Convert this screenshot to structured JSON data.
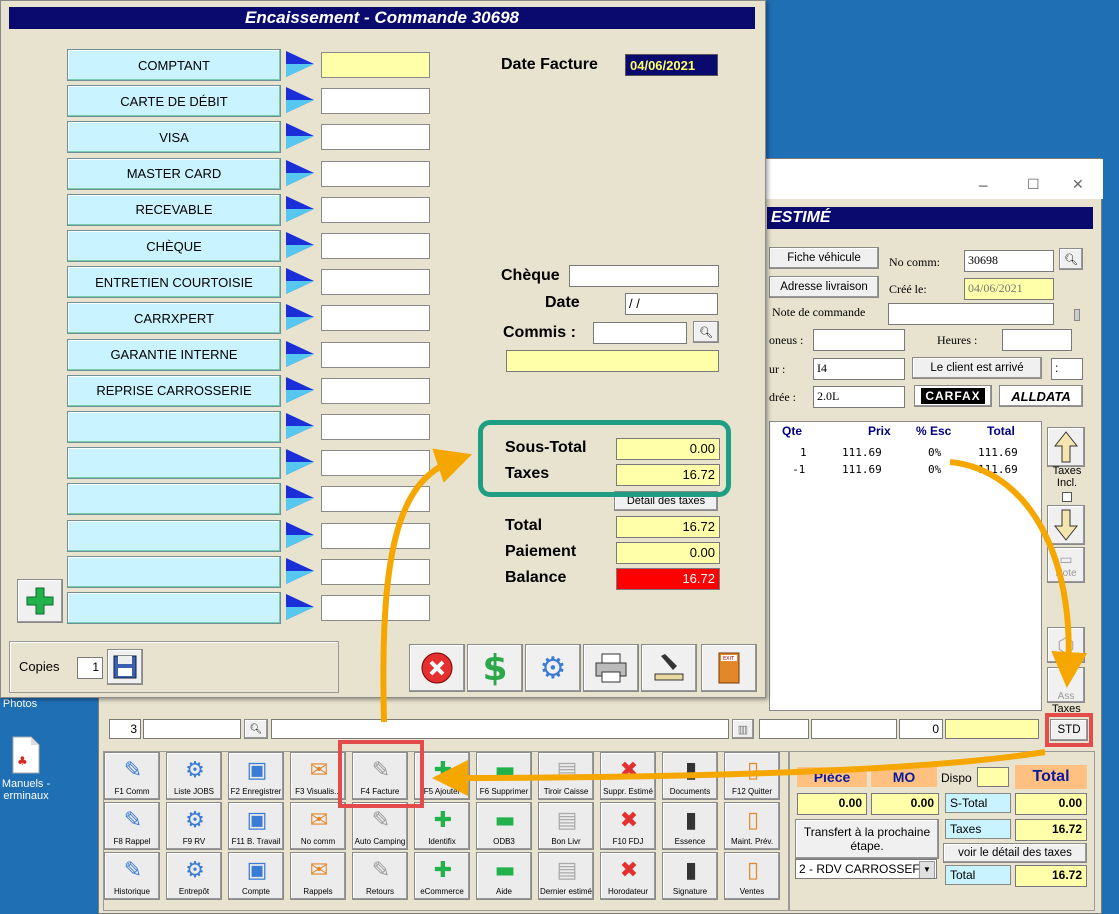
{
  "desktop": {
    "icon1_label": "Photos",
    "icon2_label": "Manuels -\nerminaux"
  },
  "front": {
    "title": "Encaissement - Commande 30698",
    "payment_methods": [
      "COMPTANT",
      "CARTE DE DÉBIT",
      "VISA",
      "MASTER CARD",
      "RECEVABLE",
      "CHÈQUE",
      "ENTRETIEN COURTOISIE",
      "CARRXPERT",
      "GARANTIE INTERNE",
      "REPRISE CARROSSERIE",
      "",
      "",
      "",
      "",
      "",
      ""
    ],
    "date_facture_label": "Date Facture",
    "date_facture_value": "04/06/2021",
    "cheque_label": "Chèque",
    "date_label": "Date",
    "date_value": " / /",
    "commis_label": "Commis :",
    "sous_total_label": "Sous-Total",
    "sous_total_value": "0.00",
    "taxes_label": "Taxes",
    "taxes_value": "16.72",
    "detail_taxes_btn": "Détail des taxes",
    "total_label": "Total",
    "total_value": "16.72",
    "paiement_label": "Paiement",
    "paiement_value": "0.00",
    "balance_label": "Balance",
    "balance_value": "16.72",
    "copies_label": "Copies",
    "copies_value": "1",
    "colors": {
      "balance_bg": "#ff0000",
      "title_bg": "#0a0a6e",
      "pay_btn_bg": "#c9f3ff"
    }
  },
  "back": {
    "title": "ESTIMÉ",
    "fiche_btn": "Fiche véhicule",
    "adresse_btn": "Adresse livraison",
    "note_label": "Note de commande",
    "no_comm_label": "No comm:",
    "no_comm_value": "30698",
    "cree_label": "Créé le:",
    "cree_value": "04/06/2021",
    "pneus_label": "oneus :",
    "heures_label": "Heures :",
    "moteur_label": "ur :",
    "moteur_value": "I4",
    "client_btn": "Le client est arrivé",
    "cyl_label": "drée :",
    "cyl_value": "2.0L",
    "carfax": "CARFAX",
    "alldata": "ALLDATA",
    "table_headers": [
      "Qte",
      "Prix",
      "% Esc",
      "Total"
    ],
    "rows": [
      {
        "qte": "1",
        "prix": "111.69",
        "esc": "0%",
        "total": "111.69"
      },
      {
        "qte": "-1",
        "prix": "111.69",
        "esc": "0%",
        "total": "111.69"
      }
    ],
    "taxes_incl_label": "Taxes Incl.",
    "note_btn": "Note",
    "ass_label": "Ass",
    "taxes_side_label": "Taxes",
    "std_btn": "STD",
    "line_qty": "3",
    "line_zero": "0",
    "piece_label": "Pièce",
    "mo_label": "MO",
    "dispo_label": "Dispo",
    "total_label": "Total",
    "piece_value": "0.00",
    "mo_value": "0.00",
    "stotal_label": "S-Total",
    "stotal_value": "0.00",
    "taxes_label": "Taxes",
    "taxes_value": "16.72",
    "total_value": "16.72",
    "transfert_btn": "Transfert à la prochaine étape.",
    "detail_taxes_btn": "voir le détail des taxes",
    "etape_value": "2 - RDV CARROSSEF",
    "toolbar": [
      [
        "F1 Comm",
        "Liste JOBS",
        "F2 Enregistrer",
        "F3 Visualis...",
        "F4  Facture",
        "F5 Ajouter",
        "F6 Supprimer",
        "Tiroir Caisse",
        "Suppr. Estimé",
        "Documents",
        "F12 Quitter"
      ],
      [
        "F8 Rappel",
        "F9 RV",
        "F11 B. Travail",
        "No comm",
        "Auto Camping",
        "Identifix",
        "ODB3",
        "Bon Livr",
        "F10 FDJ",
        "Essence",
        "Maint. Prév."
      ],
      [
        "Historique",
        "Entrepôt",
        "Compte",
        "Rappels",
        "Retours",
        "eCommerce",
        "Aide",
        "Dernier estimé",
        "Horodateur",
        "Signature",
        "Ventes"
      ]
    ]
  }
}
